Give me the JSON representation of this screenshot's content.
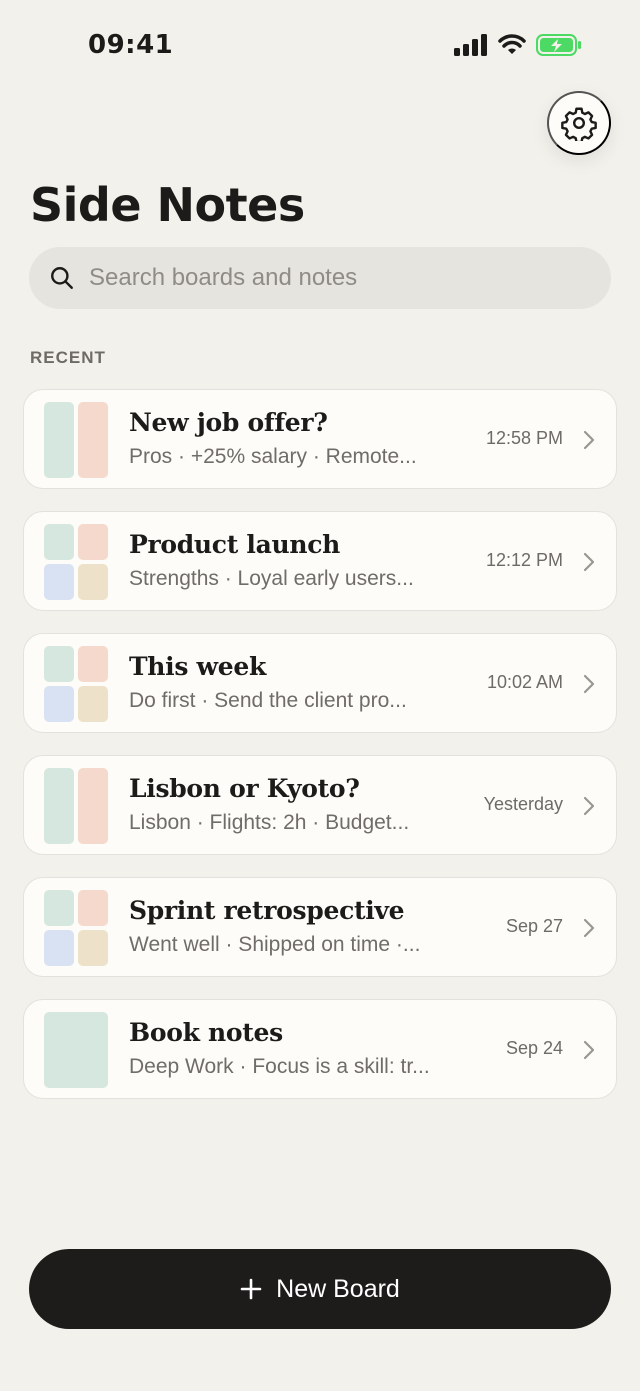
{
  "status": {
    "time": "09:41"
  },
  "header": {
    "title": "Side Notes"
  },
  "search": {
    "placeholder": "Search boards and notes"
  },
  "section": {
    "label": "RECENT"
  },
  "boards": [
    {
      "title": "New job offer?",
      "subtitle": "Pros · +25% salary · Remote...",
      "time": "12:58 PM",
      "layout": "two-column"
    },
    {
      "title": "Product launch",
      "subtitle": "Strengths · Loyal early users...",
      "time": "12:12 PM",
      "layout": "grid"
    },
    {
      "title": "This week",
      "subtitle": "Do first · Send the client pro...",
      "time": "10:02 AM",
      "layout": "grid"
    },
    {
      "title": "Lisbon or Kyoto?",
      "subtitle": "Lisbon · Flights: 2h · Budget...",
      "time": "Yesterday",
      "layout": "two-column"
    },
    {
      "title": "Sprint retrospective",
      "subtitle": "Went well · Shipped on time ·...",
      "time": "Sep 27",
      "layout": "grid"
    },
    {
      "title": "Book notes",
      "subtitle": "Deep Work · Focus is a skill: tr...",
      "time": "Sep 24",
      "layout": "single"
    }
  ],
  "actions": {
    "new_board": "New Board"
  },
  "colors": {
    "background": "#f3f1eb",
    "mint": "#d6e7df",
    "peach": "#f6d9cd",
    "blue": "#d8e2f2",
    "sand": "#ede2c9",
    "button": "#1d1c1a",
    "battery": "#4cd964"
  }
}
